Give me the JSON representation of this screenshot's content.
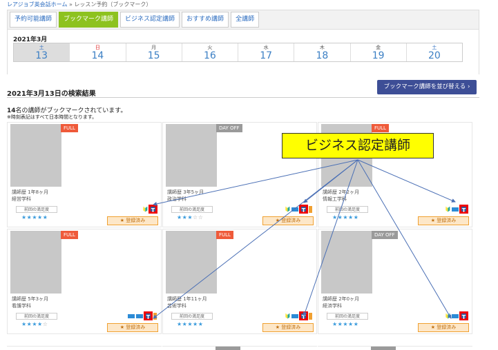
{
  "breadcrumb": {
    "home": "レアジョブ英会話ホーム",
    "separator": " » ",
    "current": "レッスン予約（ブックマーク）"
  },
  "tabs": [
    {
      "label": "予約可能講師"
    },
    {
      "label": "ブックマーク講師"
    },
    {
      "label": "ビジネス認定講師"
    },
    {
      "label": "おすすめ講師"
    },
    {
      "label": "全講師"
    }
  ],
  "calendar": {
    "month": "2021年3月",
    "days": [
      {
        "weekday": "土",
        "date": "13"
      },
      {
        "weekday": "日",
        "date": "14"
      },
      {
        "weekday": "月",
        "date": "15"
      },
      {
        "weekday": "火",
        "date": "16"
      },
      {
        "weekday": "水",
        "date": "17"
      },
      {
        "weekday": "木",
        "date": "18"
      },
      {
        "weekday": "金",
        "date": "19"
      },
      {
        "weekday": "土",
        "date": "20"
      }
    ]
  },
  "results": {
    "title": "2021年3月13日の検索結果",
    "sort_button": "ブックマーク講師を並び替える ›",
    "count_number": "14",
    "count_text": "名の講師がブックマークされています。",
    "note": "※時刻表記はすべて日本時間となります。"
  },
  "tutors": [
    {
      "status": "FULL",
      "experience": "講師歴 1年8ヶ月",
      "major": "経営学科",
      "satisfaction_label": "前回の満足度",
      "stars_on": "★★★★★",
      "stars_off": "",
      "register": "★ 登録済み"
    },
    {
      "status": "DAY OFF",
      "experience": "講師歴 3年5ヶ月",
      "major": "政治学科",
      "satisfaction_label": "前回の満足度",
      "stars_on": "★★★",
      "stars_off": "☆☆",
      "register": "★ 登録済み"
    },
    {
      "status": "FULL",
      "experience": "講師歴 2年2ヶ月",
      "major": "情報工学科",
      "satisfaction_label": "前回の満足度",
      "stars_on": "★★★★★",
      "stars_off": "",
      "register": "★ 登録済み"
    },
    {
      "status": "FULL",
      "experience": "講師歴 5年3ヶ月",
      "major": "看護学科",
      "satisfaction_label": "前回の満足度",
      "stars_on": "★★★★",
      "stars_off": "☆",
      "register": "★ 登録済み"
    },
    {
      "status": "FULL",
      "experience": "講師歴 1年11ヶ月",
      "major": "芸術学科",
      "satisfaction_label": "前回の満足度",
      "stars_on": "★★★★★",
      "stars_off": "",
      "register": "★ 登録済み"
    },
    {
      "status": "DAY OFF",
      "experience": "講師歴 2年0ヶ月",
      "major": "経済学科",
      "satisfaction_label": "前回の満足度",
      "stars_on": "★★★★★",
      "stars_off": "",
      "register": "★ 登録済み"
    }
  ],
  "row3_status": "DAY OFF",
  "icons": {
    "beginner": "🔰",
    "business": "T"
  },
  "callout": {
    "text": "ビジネス認定講師"
  },
  "colors": {
    "tab_active": "#8dc21f",
    "full": "#ef5a3a",
    "day_off": "#9a9a9a",
    "sort_button": "#3d4e96",
    "callout": "#ffff00",
    "highlight": "#ee0000"
  }
}
